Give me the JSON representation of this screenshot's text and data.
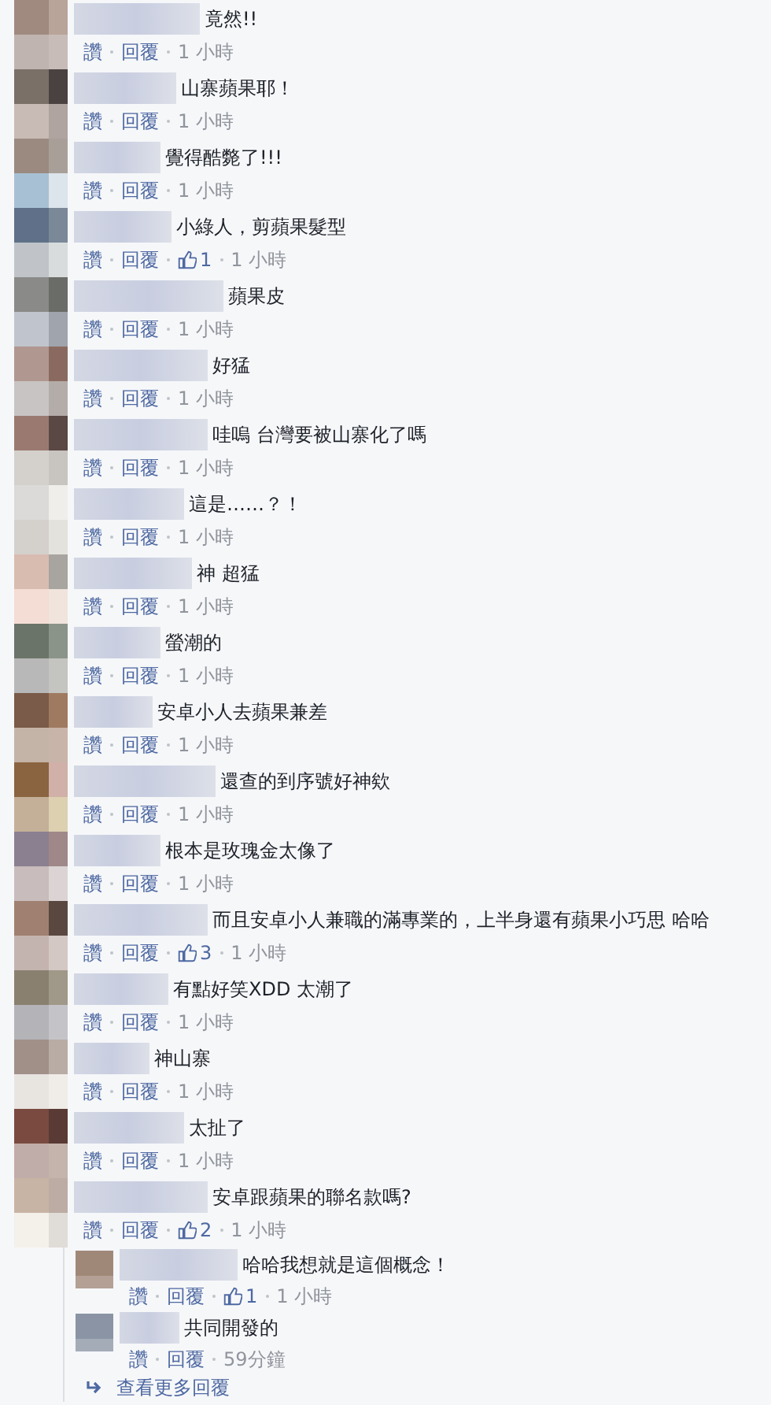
{
  "comments": [
    {
      "text": "竟然!!",
      "like_label": "讚",
      "reply_label": "回覆",
      "time": "1 小時"
    },
    {
      "text": "山寨蘋果耶！",
      "like_label": "讚",
      "reply_label": "回覆",
      "time": "1 小時"
    },
    {
      "text": "覺得酷斃了!!!",
      "like_label": "讚",
      "reply_label": "回覆",
      "time": "1 小時"
    },
    {
      "text": "小綠人，剪蘋果髮型",
      "like_label": "讚",
      "reply_label": "回覆",
      "likes": "1",
      "time": "1 小時"
    },
    {
      "text": "蘋果皮",
      "like_label": "讚",
      "reply_label": "回覆",
      "time": "1 小時"
    },
    {
      "text": "好猛",
      "like_label": "讚",
      "reply_label": "回覆",
      "time": "1 小時"
    },
    {
      "text": "哇嗚 台灣要被山寨化了嗎",
      "like_label": "讚",
      "reply_label": "回覆",
      "time": "1 小時"
    },
    {
      "text": "這是……？！",
      "like_label": "讚",
      "reply_label": "回覆",
      "time": "1 小時"
    },
    {
      "text": "神 超猛",
      "like_label": "讚",
      "reply_label": "回覆",
      "time": "1 小時"
    },
    {
      "text": "螢潮的",
      "like_label": "讚",
      "reply_label": "回覆",
      "time": "1 小時"
    },
    {
      "text": "安卓小人去蘋果兼差",
      "like_label": "讚",
      "reply_label": "回覆",
      "time": "1 小時"
    },
    {
      "text": "還查的到序號好神欸",
      "like_label": "讚",
      "reply_label": "回覆",
      "time": "1 小時"
    },
    {
      "text": "根本是玫瑰金太像了",
      "like_label": "讚",
      "reply_label": "回覆",
      "time": "1 小時"
    },
    {
      "text": "而且安卓小人兼職的滿專業的，上半身還有蘋果小巧思 哈哈",
      "like_label": "讚",
      "reply_label": "回覆",
      "likes": "3",
      "time": "1 小時"
    },
    {
      "text": "有點好笑XDD 太潮了",
      "like_label": "讚",
      "reply_label": "回覆",
      "time": "1 小時"
    },
    {
      "text": "神山寨",
      "like_label": "讚",
      "reply_label": "回覆",
      "time": "1 小時"
    },
    {
      "text": "太扯了",
      "like_label": "讚",
      "reply_label": "回覆",
      "time": "1 小時"
    },
    {
      "text": "安卓跟蘋果的聯名款嗎?",
      "like_label": "讚",
      "reply_label": "回覆",
      "likes": "2",
      "time": "1 小時",
      "children": [
        {
          "text": "哈哈我想就是這個概念！",
          "like_label": "讚",
          "reply_label": "回覆",
          "likes": "1",
          "time": "1 小時"
        },
        {
          "text": "共同開發的",
          "like_label": "讚",
          "reply_label": "回覆",
          "time": "59分鐘"
        }
      ]
    }
  ],
  "more_replies": "查看更多回覆"
}
